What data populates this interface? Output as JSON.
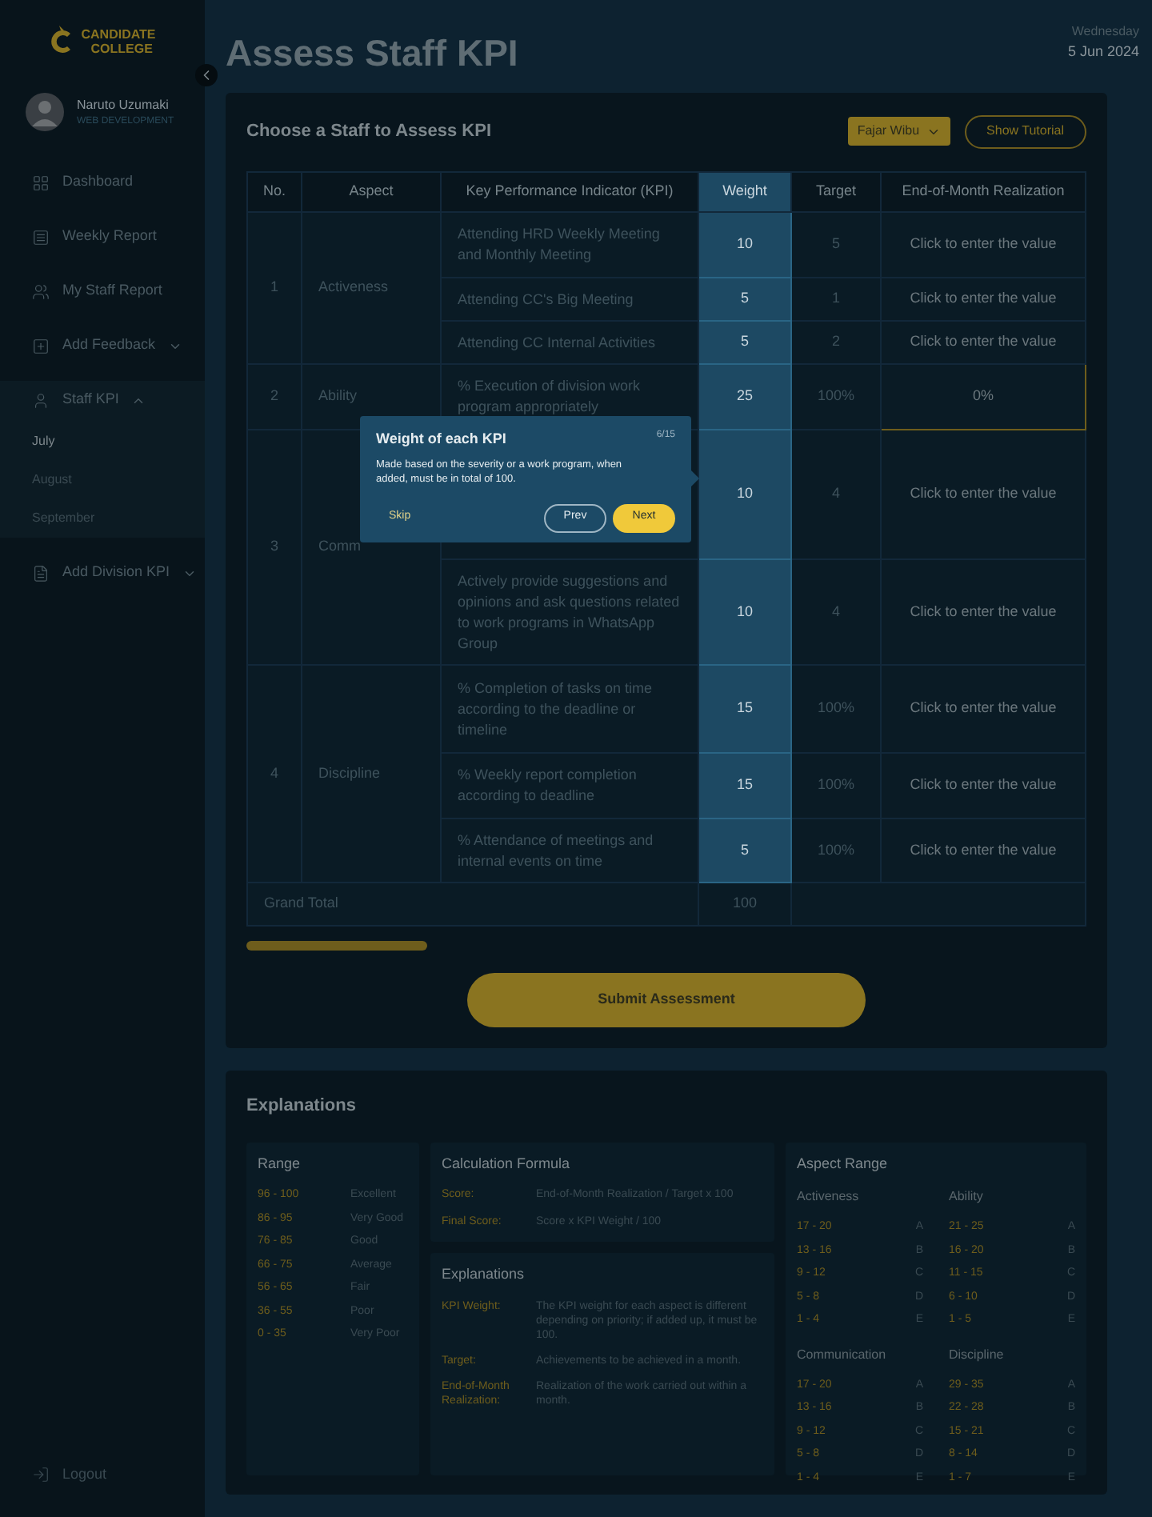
{
  "sidebar": {
    "logo": {
      "line1": "CANDIDATE",
      "line2": "COLLEGE"
    },
    "user": {
      "name": "Naruto Uzumaki",
      "role": "WEB DEVELOPMENT"
    },
    "items": [
      {
        "label": "Dashboard",
        "kind": "link"
      },
      {
        "label": "Weekly Report",
        "kind": "link"
      },
      {
        "label": "My Staff Report",
        "kind": "link"
      },
      {
        "label": "Add Feedback",
        "kind": "group",
        "expanded": false
      },
      {
        "label": "Staff KPI",
        "kind": "group",
        "expanded": true,
        "children": [
          {
            "label": "July",
            "selected": true
          },
          {
            "label": "August",
            "selected": false
          },
          {
            "label": "September",
            "selected": false
          }
        ]
      },
      {
        "label": "Add Division KPI",
        "kind": "group",
        "expanded": false
      }
    ],
    "logout": "Logout"
  },
  "header": {
    "title": "Assess Staff KPI",
    "day": "Wednesday",
    "date": "5 Jun 2024"
  },
  "assessment": {
    "title": "Choose a  Staff to Assess KPI",
    "staff_select": "Fajar Wibu",
    "tutorial_button": "Show Tutorial",
    "columns": [
      "No.",
      "Aspect",
      "Key Performance Indicator (KPI)",
      "Weight",
      "Target",
      "End-of-Month Realization"
    ],
    "groups": [
      {
        "no": "1",
        "aspect": "Activeness",
        "rows": [
          {
            "kpi": "Attending HRD Weekly Meeting and Monthly Meeting",
            "weight": "10",
            "target": "5",
            "realization": "Click to enter the value",
            "selected": false
          },
          {
            "kpi": "Attending CC's Big Meeting",
            "weight": "5",
            "target": "1",
            "realization": "Click to enter the value",
            "selected": false
          },
          {
            "kpi": "Attending CC Internal Activities",
            "weight": "5",
            "target": "2",
            "realization": "Click to enter the value",
            "selected": false
          }
        ]
      },
      {
        "no": "2",
        "aspect": "Ability",
        "rows": [
          {
            "kpi": "% Execution of division work program appropriately",
            "weight": "25",
            "target": "100%",
            "realization": "0%",
            "selected": true
          }
        ]
      },
      {
        "no": "3",
        "aspect": "Comm",
        "rows": [
          {
            "weight": "10",
            "target": "4",
            "realization": "Click to enter the value",
            "selected": false
          },
          {
            "kpi": "Actively provide suggestions and opinions and ask questions related to work programs in WhatsApp Group",
            "weight": "10",
            "target": "4",
            "realization": "Click to enter the value",
            "selected": false
          }
        ]
      },
      {
        "no": "4",
        "aspect": "Discipline",
        "rows": [
          {
            "kpi": "% Completion of tasks on time according to the deadline or timeline",
            "weight": "15",
            "target": "100%",
            "realization": "Click to enter the value",
            "selected": false
          },
          {
            "kpi": "% Weekly report completion according to deadline",
            "weight": "15",
            "target": "100%",
            "realization": "Click to enter the value",
            "selected": false
          },
          {
            "kpi": "% Attendance of meetings and internal events on time",
            "weight": "5",
            "target": "100%",
            "realization": "Click to enter the value",
            "selected": false
          }
        ]
      }
    ],
    "grand_total": {
      "label": "Grand Total",
      "weight": "100"
    },
    "submit_button": "Submit Assessment"
  },
  "tooltip": {
    "title": "Weight of each KPI",
    "step": "6/15",
    "body": "Made based on the severity or a work program, when added, must be in total of 100.",
    "skip": "Skip",
    "prev": "Prev",
    "next": "Next"
  },
  "explanations": {
    "title": "Explanations",
    "range": {
      "title": "Range",
      "items": [
        {
          "range": "96 - 100",
          "label": "Excellent"
        },
        {
          "range": "86 - 95",
          "label": "Very Good"
        },
        {
          "range": "76 - 85",
          "label": "Good"
        },
        {
          "range": "66 - 75",
          "label": "Average"
        },
        {
          "range": "56 - 65",
          "label": "Fair"
        },
        {
          "range": "36 - 55",
          "label": "Poor"
        },
        {
          "range": "0 - 35",
          "label": "Very Poor"
        }
      ]
    },
    "formula": {
      "title": "Calculation Formula",
      "items": [
        {
          "term": "Score:",
          "value": "End-of-Month Realization / Target x 100"
        },
        {
          "term": "Final Score:",
          "value": "Score x KPI Weight / 100"
        }
      ]
    },
    "notes": {
      "title": "Explanations",
      "items": [
        {
          "term": "KPI Weight:",
          "value": "The KPI weight for each aspect is different depending on priority; if added up, it must be 100."
        },
        {
          "term": "Target:",
          "value": "Achievements to be achieved in a month."
        },
        {
          "term": "End-of-Month Realization:",
          "value": "Realization of the work carried out within a month."
        }
      ]
    },
    "aspect_range": {
      "title": "Aspect Range",
      "groups": [
        {
          "name": "Activeness",
          "items": [
            {
              "range": "17 - 20",
              "grade": "A"
            },
            {
              "range": "13 - 16",
              "grade": "B"
            },
            {
              "range": "9 - 12",
              "grade": "C"
            },
            {
              "range": "5 - 8",
              "grade": "D"
            },
            {
              "range": "1 - 4",
              "grade": "E"
            }
          ]
        },
        {
          "name": "Ability",
          "items": [
            {
              "range": "21 - 25",
              "grade": "A"
            },
            {
              "range": "16 - 20",
              "grade": "B"
            },
            {
              "range": "11 - 15",
              "grade": "C"
            },
            {
              "range": "6 - 10",
              "grade": "D"
            },
            {
              "range": "1 - 5",
              "grade": "E"
            }
          ]
        },
        {
          "name": "Communication",
          "items": [
            {
              "range": "17 - 20",
              "grade": "A"
            },
            {
              "range": "13 - 16",
              "grade": "B"
            },
            {
              "range": "9 - 12",
              "grade": "C"
            },
            {
              "range": "5 - 8",
              "grade": "D"
            },
            {
              "range": "1 - 4",
              "grade": "E"
            }
          ]
        },
        {
          "name": "Discipline",
          "items": [
            {
              "range": "29 - 35",
              "grade": "A"
            },
            {
              "range": "22 - 28",
              "grade": "B"
            },
            {
              "range": "15 - 21",
              "grade": "C"
            },
            {
              "range": "8 - 14",
              "grade": "D"
            },
            {
              "range": "1 - 7",
              "grade": "E"
            }
          ]
        }
      ]
    }
  }
}
